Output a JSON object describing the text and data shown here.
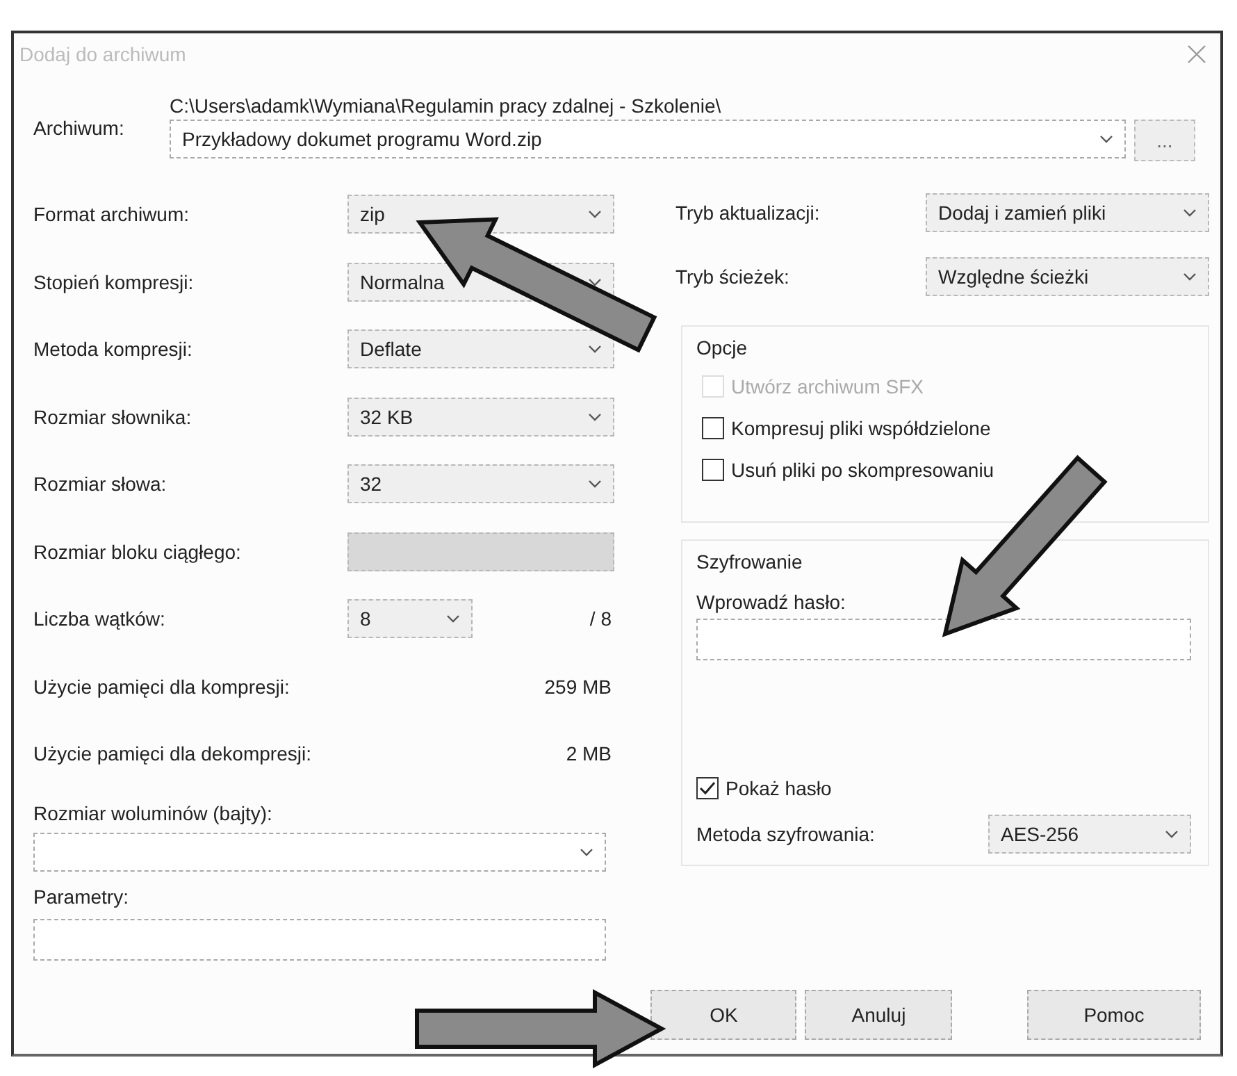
{
  "window": {
    "title": "Dodaj do archiwum"
  },
  "archive": {
    "label": "Archiwum:",
    "path": "C:\\Users\\adamk\\Wymiana\\Regulamin pracy zdalnej - Szkolenie\\",
    "value": "Przykładowy dokumet programu Word.zip",
    "browse": "..."
  },
  "settings": [
    {
      "kind": "combo",
      "label": "Format archiwum:",
      "value": "zip",
      "disabled": false
    },
    {
      "kind": "combo",
      "label": "Stopień kompresji:",
      "value": "Normalna",
      "disabled": false
    },
    {
      "kind": "combo",
      "label": "Metoda kompresji:",
      "value": "Deflate",
      "disabled": false
    },
    {
      "kind": "combo",
      "label": "Rozmiar słownika:",
      "value": "32 KB",
      "disabled": false
    },
    {
      "kind": "combo",
      "label": "Rozmiar słowa:",
      "value": "32",
      "disabled": false
    },
    {
      "kind": "combo",
      "label": "Rozmiar bloku ciągłego:",
      "disabled": true
    },
    {
      "kind": "threads",
      "label": "Liczba wątków:",
      "value": "8",
      "suffix": "/ 8",
      "disabled": false
    },
    {
      "kind": "readout",
      "label": "Użycie pamięci dla kompresji:",
      "value": "259 MB"
    },
    {
      "kind": "readout",
      "label": "Użycie pamięci dla dekompresji:",
      "value": "2 MB"
    }
  ],
  "volume": {
    "label": "Rozmiar woluminów (bajty):"
  },
  "parameters": {
    "label": "Parametry:"
  },
  "modes": [
    {
      "label": "Tryb aktualizacji:",
      "value": "Dodaj i zamień pliki"
    },
    {
      "label": "Tryb ścieżek:",
      "value": "Względne ścieżki"
    }
  ],
  "options": {
    "title": "Opcje",
    "items": [
      {
        "label": "Utwórz archiwum SFX",
        "checked": false,
        "disabled": true
      },
      {
        "label": "Kompresuj pliki współdzielone",
        "checked": false,
        "disabled": false
      },
      {
        "label": "Usuń pliki po skompresowaniu",
        "checked": false,
        "disabled": false
      }
    ]
  },
  "encryption": {
    "title": "Szyfrowanie",
    "password_label": "Wprowadź hasło:",
    "show_password": {
      "label": "Pokaż hasło",
      "checked": true
    },
    "method_label": "Metoda szyfrowania:",
    "method": "AES-256"
  },
  "buttons": [
    {
      "label": "OK"
    },
    {
      "label": "Anuluj"
    },
    {
      "label": "Pomoc"
    }
  ]
}
